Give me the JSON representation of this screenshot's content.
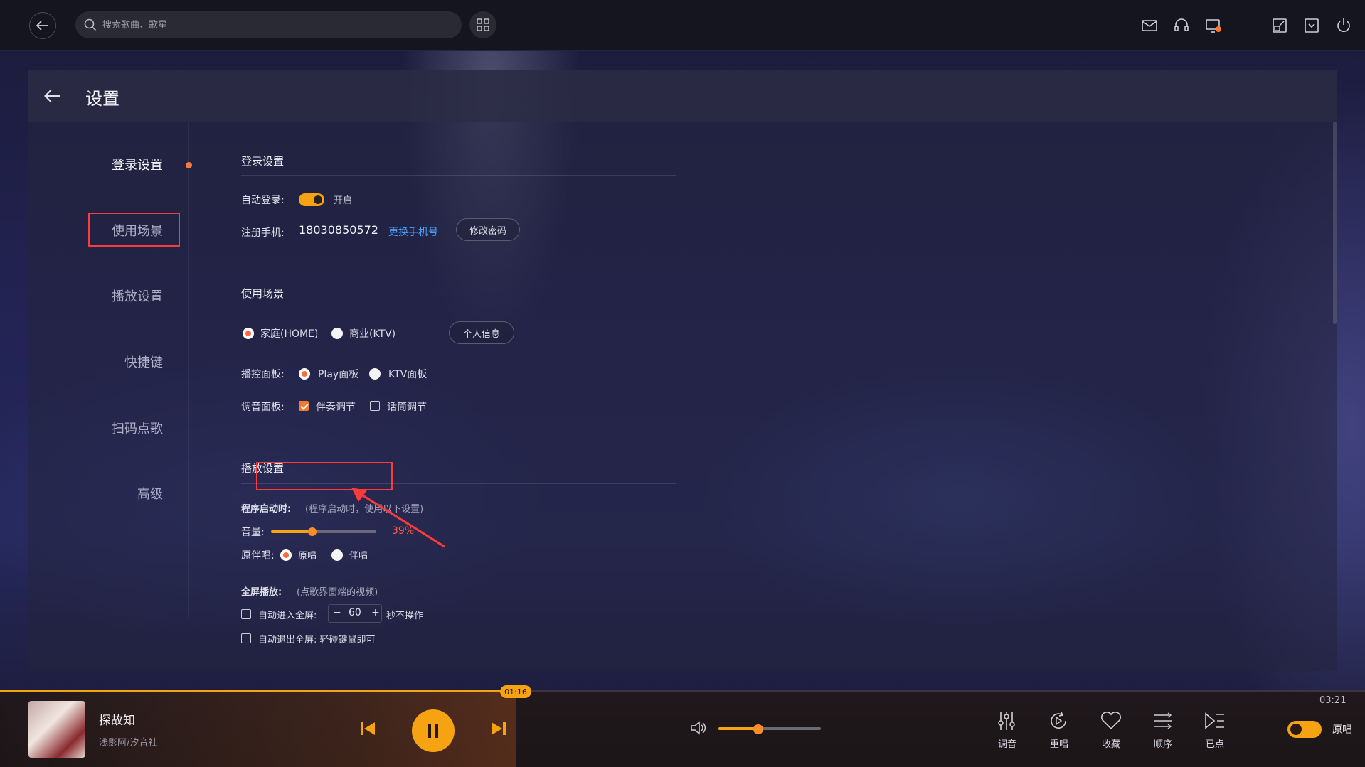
{
  "topbar": {
    "search_placeholder": "搜索歌曲、歌星",
    "icons": [
      "back-icon",
      "search-icon",
      "qrcode-icon",
      "mail-icon",
      "headset-icon",
      "screen-alert-icon",
      "minimize-window-icon",
      "download-icon",
      "power-icon"
    ]
  },
  "panel": {
    "title": "设置"
  },
  "sidebar": {
    "items": [
      {
        "label": "登录设置",
        "active": true
      },
      {
        "label": "使用场景",
        "active": false
      },
      {
        "label": "播放设置",
        "active": false
      },
      {
        "label": "快捷键",
        "active": false
      },
      {
        "label": "扫码点歌",
        "active": false
      },
      {
        "label": "高级",
        "active": false
      }
    ]
  },
  "login": {
    "section_title": "登录设置",
    "auto_login_label": "自动登录:",
    "auto_login_state": "开启",
    "phone_label": "注册手机:",
    "phone_value": "18030850572",
    "change_phone_link": "更换手机号",
    "change_password_button": "修改密码"
  },
  "scene": {
    "section_title": "使用场景",
    "home_option": "家庭(HOME)",
    "ktv_option": "商业(KTV)",
    "personal_info_button": "个人信息",
    "control_panel_label": "播控面板:",
    "play_panel_option": "Play面板",
    "ktv_panel_option": "KTV面板",
    "mixer_panel_label": "调音面板:",
    "accompaniment_option": "伴奏调节",
    "mic_option": "话筒调节"
  },
  "playback": {
    "section_title": "播放设置",
    "startup_label": "程序启动时:",
    "startup_hint": "(程序启动时，使用以下设置)",
    "volume_label": "音量:",
    "volume_value": "39%",
    "volume_fraction": 0.39,
    "vocal_label": "原伴唱:",
    "original_option": "原唱",
    "accompany_option": "伴唱",
    "fullscreen_label": "全屏播放:",
    "fullscreen_hint": "(点歌界面端的视频)",
    "auto_enter_label": "自动进入全屏:",
    "stepper_minus": "−",
    "stepper_value": "60",
    "stepper_plus": "+",
    "seconds_label": "秒不操作",
    "auto_exit_label": "自动退出全屏: 轻碰键鼠即可"
  },
  "player": {
    "song_title": "探故知",
    "artist": "浅影阿/汐音社",
    "current_time": "01:16",
    "total_time": "03:21",
    "progress_fraction": 0.378,
    "volume_fraction": 0.39,
    "buttons": [
      {
        "label": "调音",
        "icon": "equalizer-icon"
      },
      {
        "label": "重唱",
        "icon": "replay-icon"
      },
      {
        "label": "收藏",
        "icon": "heart-icon"
      },
      {
        "label": "顺序",
        "icon": "list-order-icon"
      },
      {
        "label": "已点",
        "icon": "queued-icon"
      }
    ],
    "original_toggle_label": "原唱"
  },
  "colors": {
    "accent": "#f5a312",
    "highlight_border": "#ff3a3a",
    "link": "#4aa2ff",
    "volume_percent": "#ff5a3a"
  }
}
